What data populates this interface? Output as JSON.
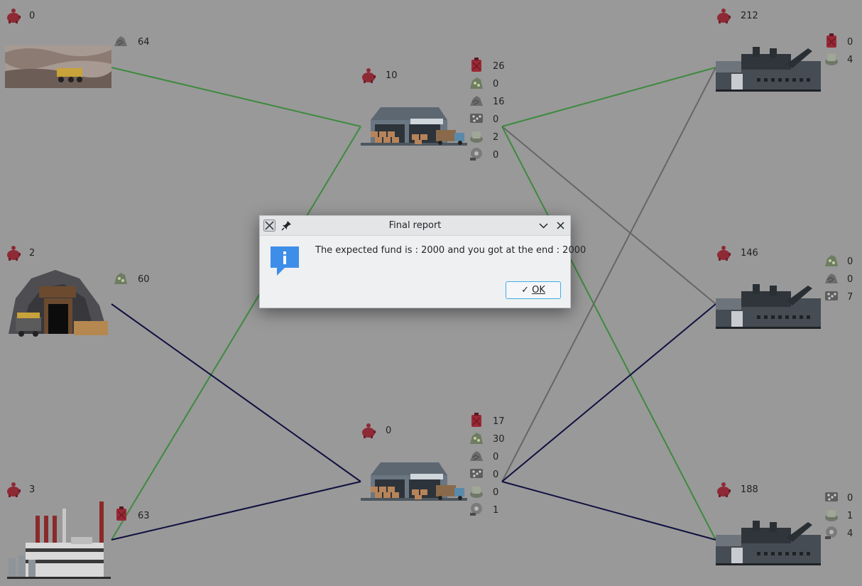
{
  "nodes": {
    "quarry": {
      "funds": "0",
      "stock": [
        "64"
      ]
    },
    "mine": {
      "funds": "2",
      "stock": [
        "60"
      ]
    },
    "refinery": {
      "funds": "3",
      "stock": [
        "63"
      ]
    },
    "warehouse_top": {
      "funds": "10",
      "stock": [
        "26",
        "0",
        "16",
        "0",
        "2",
        "0"
      ]
    },
    "warehouse_bottom": {
      "funds": "0",
      "stock": [
        "17",
        "30",
        "0",
        "0",
        "0",
        "1"
      ]
    },
    "factory_1": {
      "funds": "212",
      "stock": [
        "0",
        "4"
      ]
    },
    "factory_2": {
      "funds": "146",
      "stock": [
        "0",
        "0",
        "7"
      ]
    },
    "factory_3": {
      "funds": "188",
      "stock": [
        "0",
        "1",
        "4"
      ]
    }
  },
  "icons": {
    "funds": "piggy-bank-icon",
    "fuel": "fuel-can-icon",
    "stone": "stone-pile-icon",
    "ore": "ore-icon",
    "gravel": "gravel-icon",
    "cement": "cement-bag-icon",
    "tools": "machine-parts-icon"
  },
  "dialog": {
    "title": "Final report",
    "message": "The expected fund is : 2000 and you got at the end : 2000",
    "ok_label": "OK"
  },
  "colors": {
    "background": "#999999",
    "route_green": "#3e8a3e",
    "route_navy": "#101040",
    "route_gray": "#666666"
  }
}
